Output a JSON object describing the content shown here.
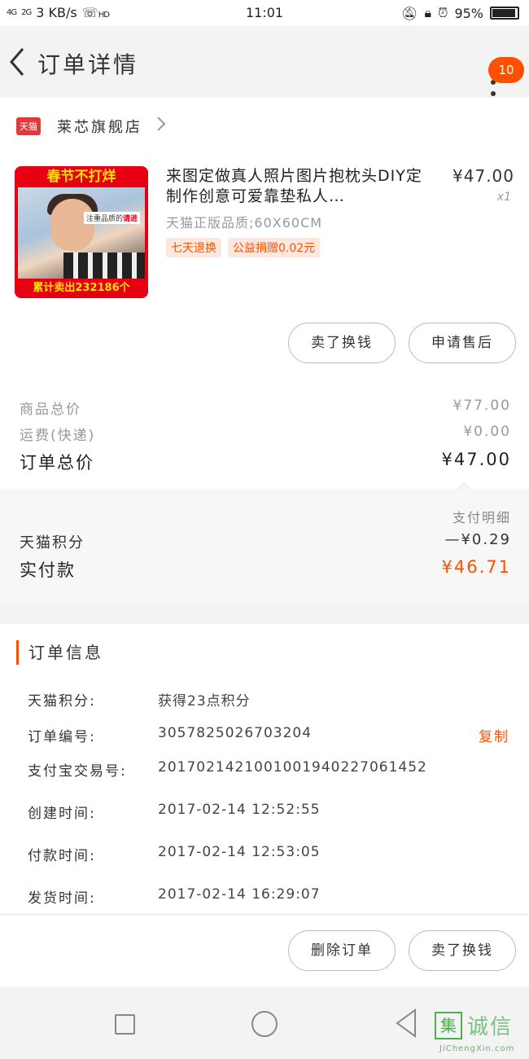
{
  "status_bar": {
    "signal1": "4G",
    "signal2": "2G",
    "speed": "3 KB/s",
    "hd": "HD",
    "time": "11:01",
    "battery": "95%"
  },
  "header": {
    "title": "订单详情",
    "badge_count": "10"
  },
  "shop": {
    "logo_text": "天猫",
    "name": "莱芯旗舰店"
  },
  "product": {
    "image_banner_top": "春节不打烊",
    "image_tag_prefix": "注重品质的",
    "image_tag_em": "请进",
    "image_banner_bottom": "累计卖出232186个",
    "title": "来图定做真人照片图片抱枕头DIY定制作创意可爱靠垫私人…",
    "spec": "天猫正版品质;60X60CM",
    "tags": [
      "七天退换",
      "公益捐赠0.02元"
    ],
    "price": "¥47.00",
    "quantity": "x1"
  },
  "actions_top": {
    "sell": "卖了换钱",
    "after_sale": "申请售后"
  },
  "summary": {
    "goods_total_label": "商品总价",
    "goods_total": "¥77.00",
    "shipping_label": "运费(快递)",
    "shipping": "¥0.00",
    "order_total_label": "订单总价",
    "order_total": "¥47.00"
  },
  "payment": {
    "detail_link": "支付明细",
    "points_label": "天猫积分",
    "points_value": "—¥0.29",
    "paid_label": "实付款",
    "paid_value": "¥46.71"
  },
  "order_info": {
    "section_title": "订单信息",
    "rows": [
      {
        "label": "天猫积分:",
        "value": "获得23点积分"
      },
      {
        "label": "订单编号:",
        "value": "3057825026703204"
      },
      {
        "label": "支付宝交易号:",
        "value": "2017021421001001940227061452"
      },
      {
        "label": "创建时间:",
        "value": "2017-02-14 12:52:55"
      },
      {
        "label": "付款时间:",
        "value": "2017-02-14 12:53:05"
      },
      {
        "label": "发货时间:",
        "value": "2017-02-14 16:29:07"
      }
    ],
    "copy_label": "复制"
  },
  "actions_bottom": {
    "delete": "删除订单",
    "sell": "卖了换钱"
  },
  "watermark": {
    "box": "集",
    "text": "诚信",
    "url": "JiChengXin.com"
  },
  "colors": {
    "accent": "#ff5000",
    "tmall_red": "#e4393c"
  }
}
